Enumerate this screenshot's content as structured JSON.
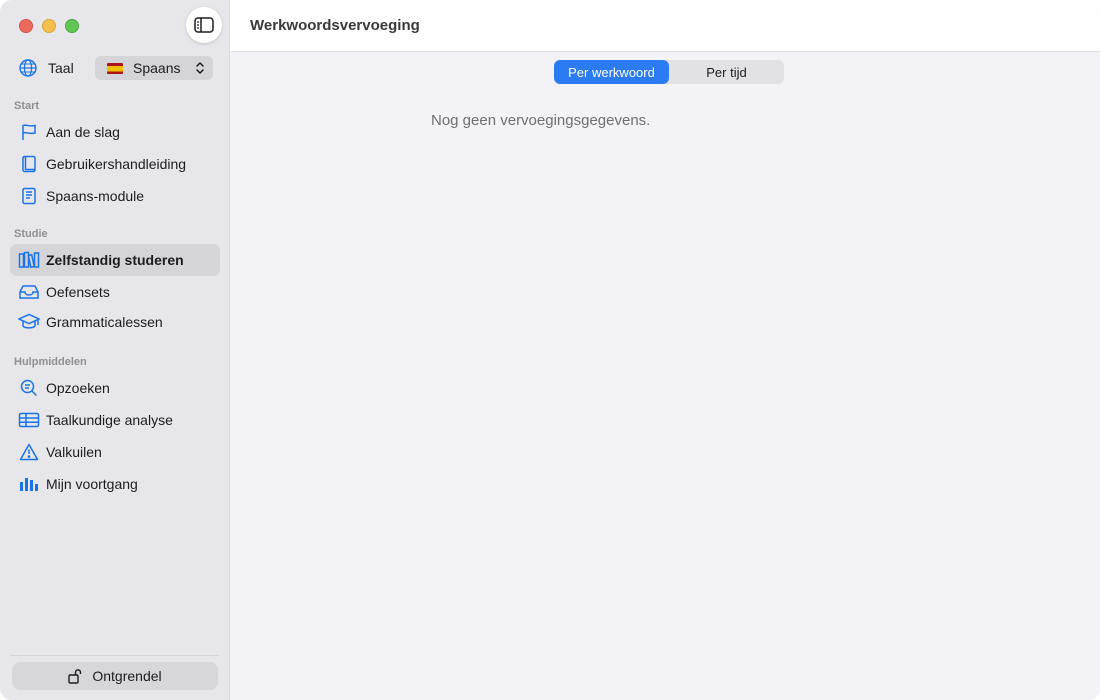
{
  "window": {
    "title": "Werkwoordsvervoeging"
  },
  "sidebar": {
    "language": {
      "label": "Taal",
      "selected": "Spaans",
      "icon": "globe-icon"
    },
    "sections": [
      {
        "title": "Start",
        "items": [
          {
            "label": "Aan de slag",
            "icon": "flag-icon"
          },
          {
            "label": "Gebruikershandleiding",
            "icon": "book-icon"
          },
          {
            "label": "Spaans-module",
            "icon": "book-closed-icon"
          }
        ]
      },
      {
        "title": "Studie",
        "items": [
          {
            "label": "Zelfstandig studeren",
            "icon": "books-icon",
            "active": true
          },
          {
            "label": "Oefensets",
            "icon": "tray-icon"
          },
          {
            "label": "Grammaticalessen",
            "icon": "graduation-cap-icon"
          }
        ]
      },
      {
        "title": "Hulpmiddelen",
        "items": [
          {
            "label": "Opzoeken",
            "icon": "magnifier-text-icon"
          },
          {
            "label": "Taalkundige analyse",
            "icon": "table-icon"
          },
          {
            "label": "Valkuilen",
            "icon": "warning-icon"
          },
          {
            "label": "Mijn voortgang",
            "icon": "bar-chart-icon"
          }
        ]
      }
    ],
    "unlock_label": "Ontgrendel"
  },
  "main": {
    "segments": [
      {
        "label": "Per werkwoord",
        "active": true
      },
      {
        "label": "Per tijd",
        "active": false
      }
    ],
    "empty_message": "Nog geen vervoegingsgegevens."
  },
  "colors": {
    "accent": "#2b7cf3",
    "icon": "#1a73e8",
    "sidebar_bg": "#e6e6eb",
    "content_bg": "#f2f2f7"
  }
}
